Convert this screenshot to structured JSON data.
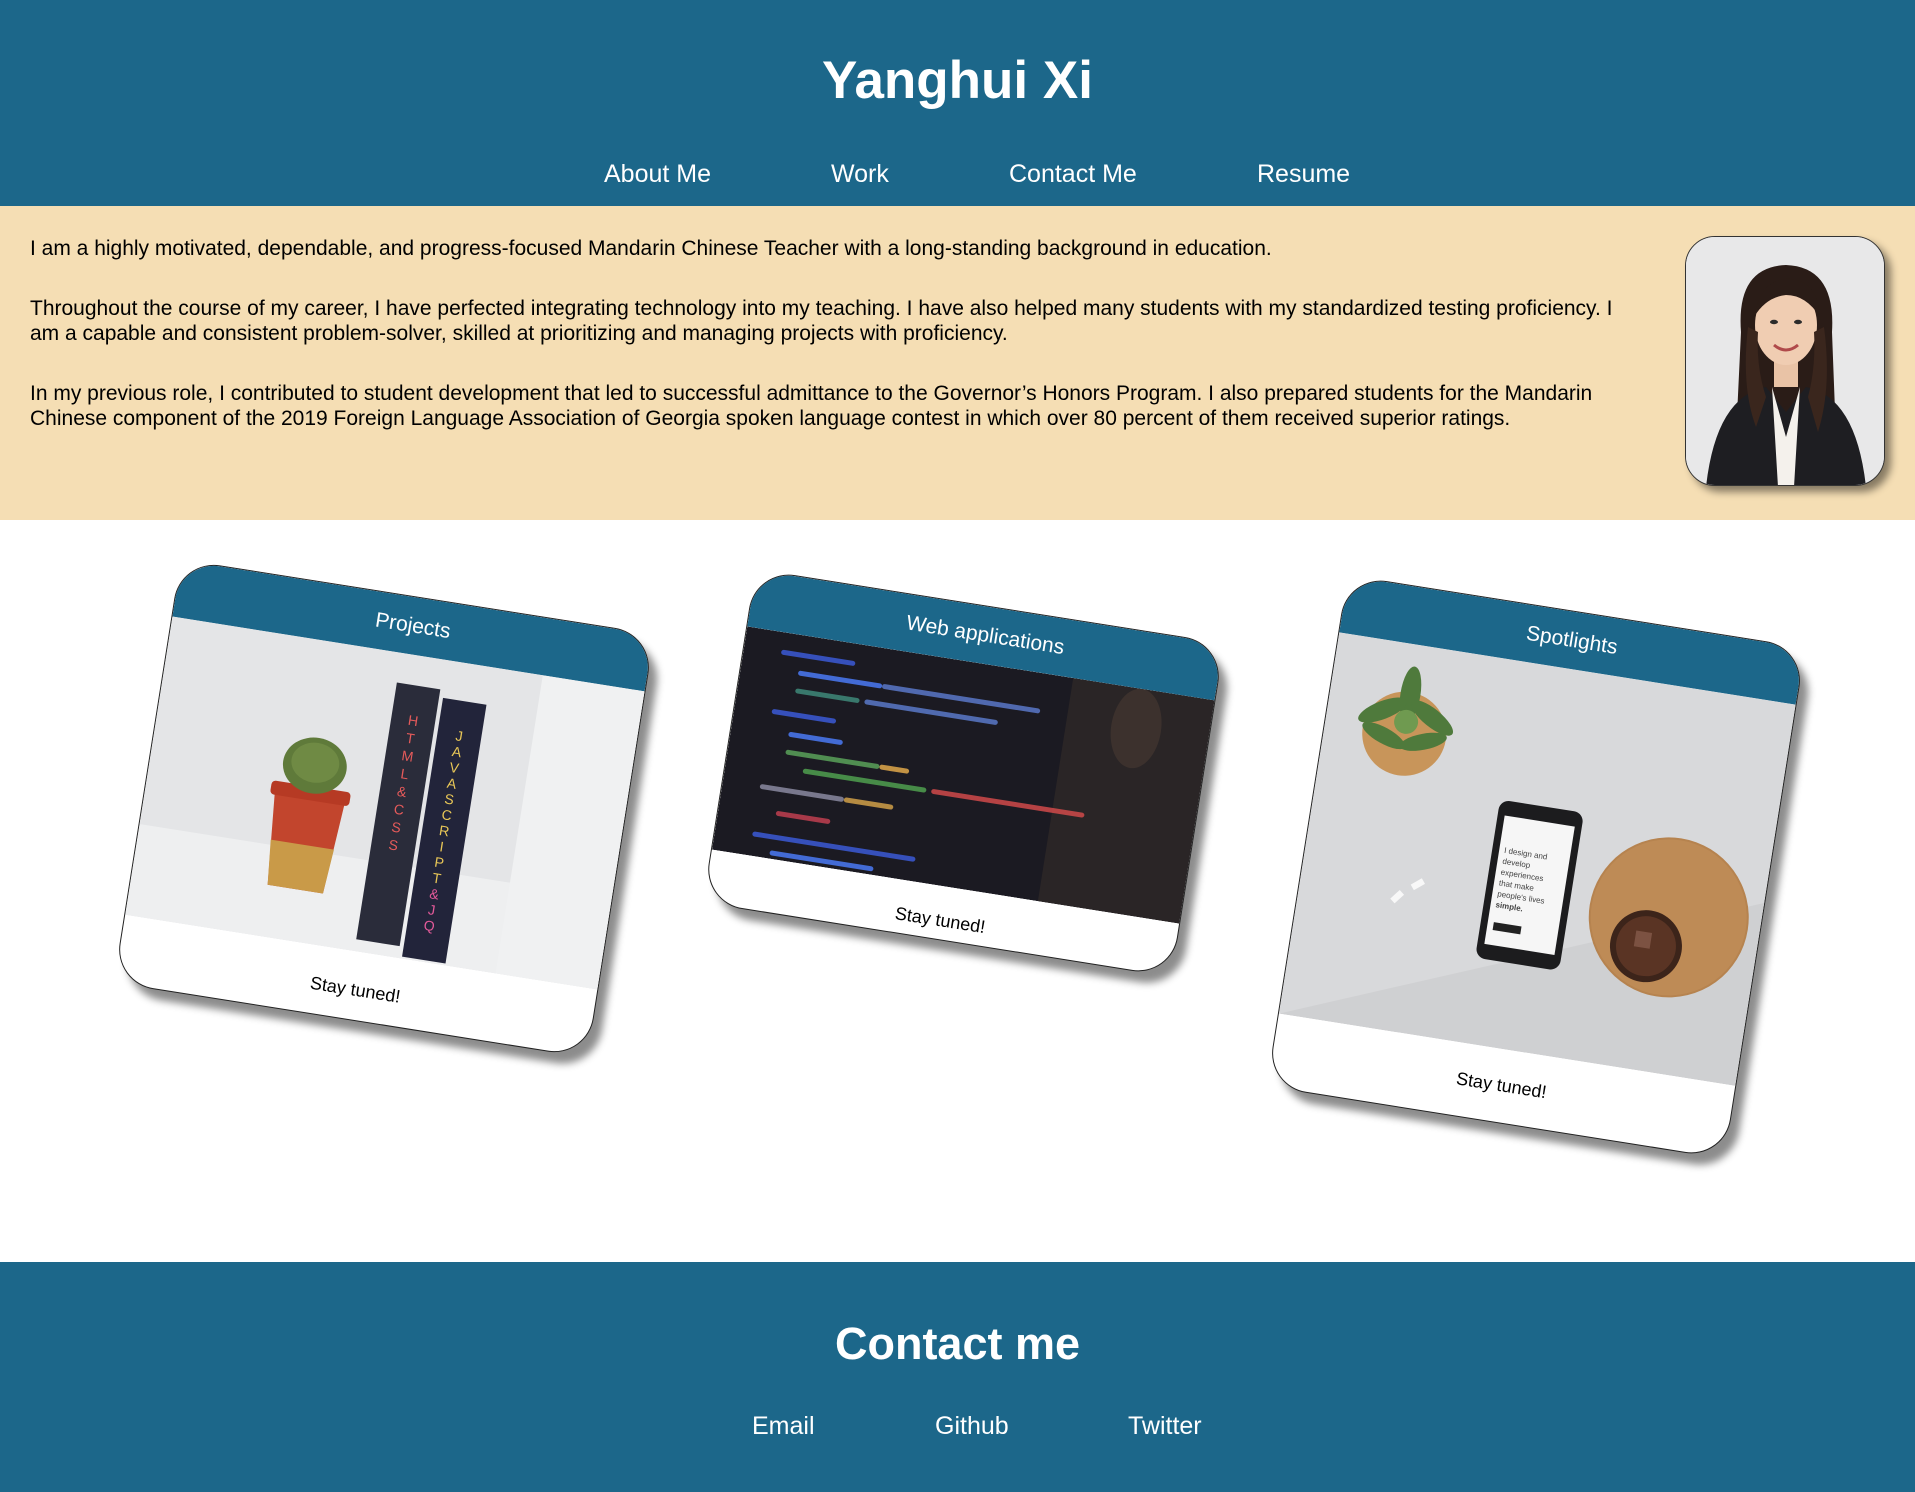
{
  "header": {
    "title": "Yanghui Xi",
    "nav": [
      "About Me",
      "Work",
      "Contact Me",
      "Resume"
    ]
  },
  "about": {
    "paragraphs": [
      "I am a highly motivated, dependable, and progress-focused Mandarin Chinese Teacher with a long-standing background in education.",
      "Throughout the course of my career, I have perfected integrating technology into my teaching. I have also helped many students with my standardized testing proficiency. I am a capable and consistent problem-solver, skilled at prioritizing and managing projects with proficiency.",
      "In my previous role, I contributed to student development that led to successful admittance to the Governor’s Honors Program. I also prepared students for the Mandarin Chinese component of the 2019 Foreign Language Association of Georgia spoken language contest in which over 80 percent of them received superior ratings."
    ],
    "portrait_icon": "portrait-photo"
  },
  "cards": [
    {
      "title": "Projects",
      "footer": "Stay tuned!",
      "image_icon": "books-and-cactus-photo",
      "book1_spine": "HTML & CSS",
      "book2_spine": "JAVASCRIPT & JQUERY"
    },
    {
      "title": "Web applications",
      "footer": "Stay tuned!",
      "image_icon": "code-screen-photo"
    },
    {
      "title": "Spotlights",
      "footer": "Stay tuned!",
      "image_icon": "phone-desk-photo",
      "phone_text": "I design and develop experiences that make people's lives simple."
    }
  ],
  "footer": {
    "title": "Contact me",
    "links": [
      "Email",
      "Github",
      "Twitter"
    ]
  },
  "colors": {
    "primary": "#1c678a",
    "about_bg": "#f5deb4",
    "text": "#000000"
  }
}
